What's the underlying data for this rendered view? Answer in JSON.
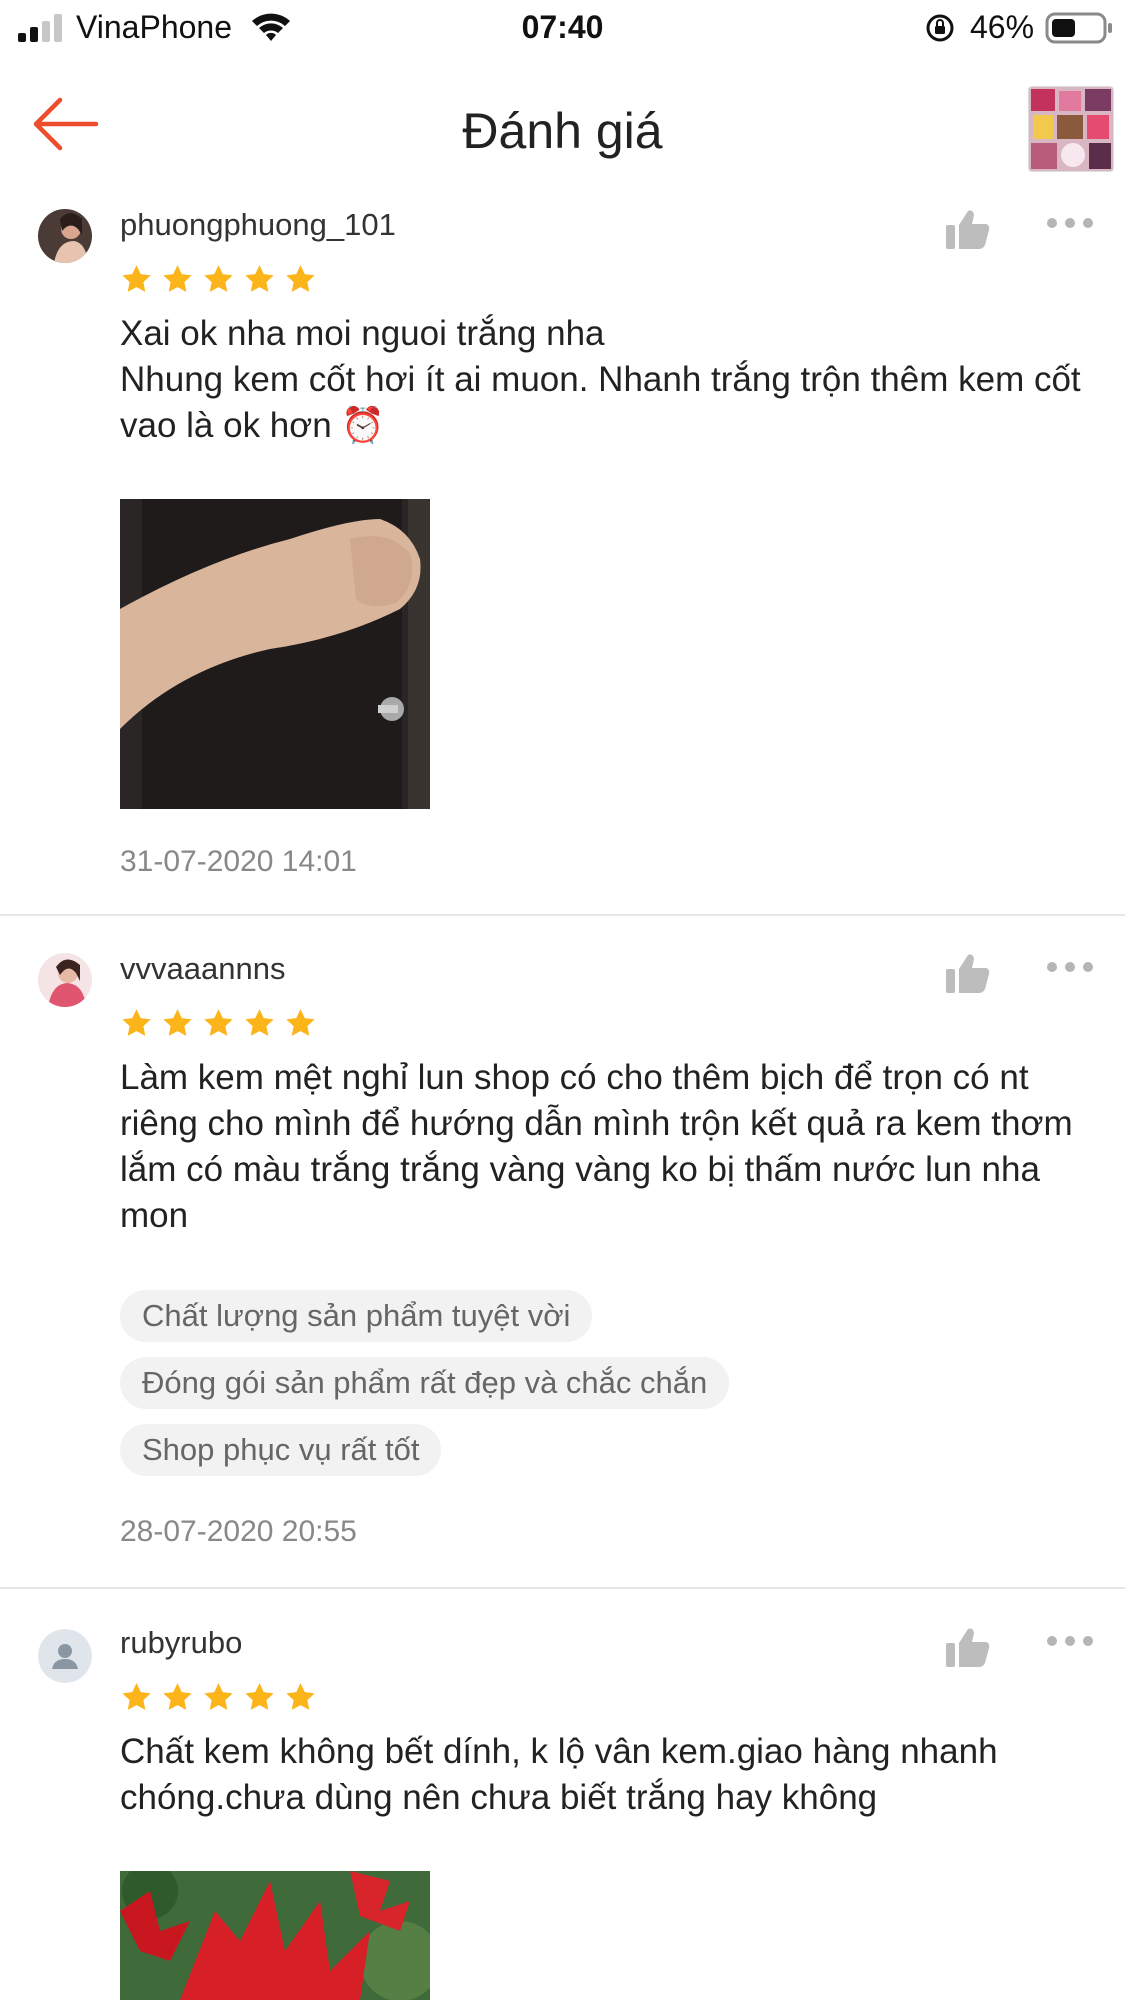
{
  "status_bar": {
    "carrier": "VinaPhone",
    "time": "07:40",
    "battery_percent": "46%",
    "signal_icon": "cellular-signal-icon",
    "wifi_icon": "wifi-icon",
    "rotation_lock_icon": "rotation-lock-icon",
    "battery_icon": "battery-icon"
  },
  "header": {
    "title": "Đánh giá",
    "back_icon": "arrow-left-icon",
    "accent_color": "#ee4d2d"
  },
  "reviews": [
    {
      "username": "phuongphuong_101",
      "rating": 5,
      "comment": "Xai ok nha moi nguoi trắng nha\nNhung kem cốt hơi ít ai muon. Nhanh trắng trộn thêm kem cốt vao là ok hơn ⏰",
      "timestamp": "31-07-2020 14:01"
    },
    {
      "username": "vvvaaannns",
      "rating": 5,
      "comment": "Làm kem mệt nghỉ lun shop có cho thêm bịch để trọn có nt riêng cho mình để hướng dẫn mình trộn kết quả ra kem thơm lắm có màu trắng trắng vàng vàng ko bị thấm nước lun nha mon",
      "tags": [
        "Chất lượng sản phẩm tuyệt vời",
        "Đóng gói sản phẩm rất đẹp và chắc chắn",
        "Shop phục vụ rất tốt"
      ],
      "timestamp": "28-07-2020 20:55"
    },
    {
      "username": "rubyrubo",
      "rating": 5,
      "comment": "Chất kem không bết dính, k lộ vân kem.giao hàng nhanh chóng.chưa dùng nên chưa biết trắng hay không"
    }
  ],
  "colors": {
    "star": "#fbb41a",
    "like_icon": "#bdbdbd",
    "divider": "#e6e6e6",
    "tag_bg": "#f2f2f2"
  }
}
